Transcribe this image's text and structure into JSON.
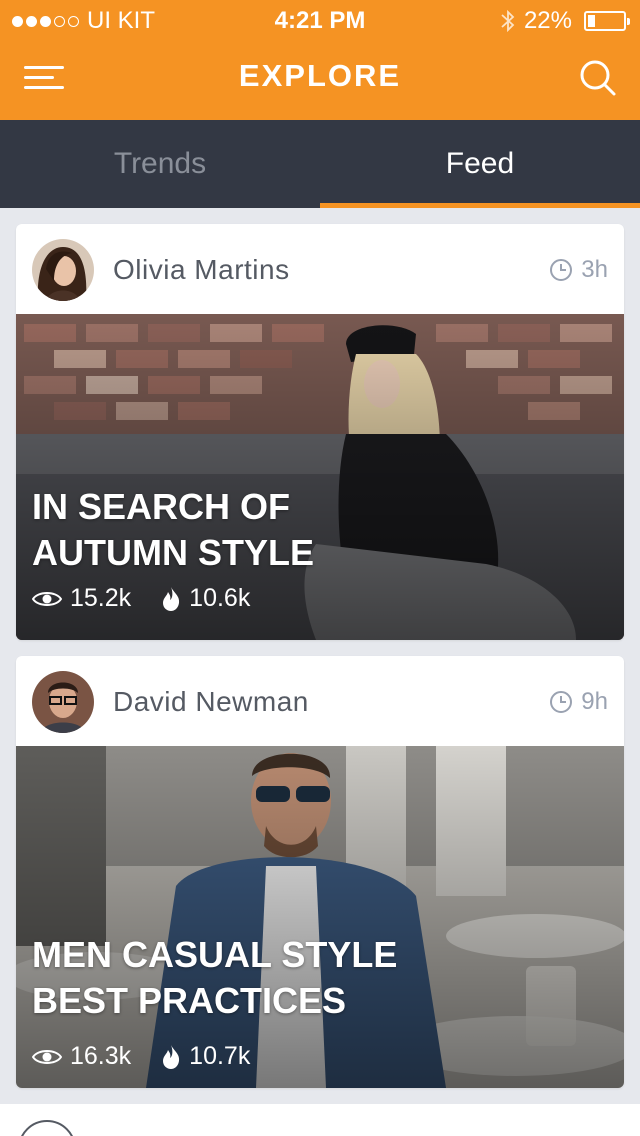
{
  "status_bar": {
    "carrier": "UI KIT",
    "time": "4:21 PM",
    "battery_percent": "22%",
    "battery_level": 0.22
  },
  "nav": {
    "title": "EXPLORE",
    "menu_icon": "hamburger-icon",
    "search_icon": "search-icon"
  },
  "tabs": [
    {
      "label": "Trends",
      "active": false
    },
    {
      "label": "Feed",
      "active": true
    }
  ],
  "colors": {
    "accent": "#f59323",
    "tab_bar": "#333844",
    "background": "#e6e8ed"
  },
  "feed": [
    {
      "author": "Olivia Martins",
      "time": "3h",
      "title_line1": "IN SEARCH OF",
      "title_line2": "AUTUMN STYLE",
      "views": "15.2k",
      "likes": "10.6k"
    },
    {
      "author": "David Newman",
      "time": "9h",
      "title_line1": "MEN CASUAL STYLE",
      "title_line2": "BEST PRACTICES",
      "views": "16.3k",
      "likes": "10.7k"
    }
  ]
}
